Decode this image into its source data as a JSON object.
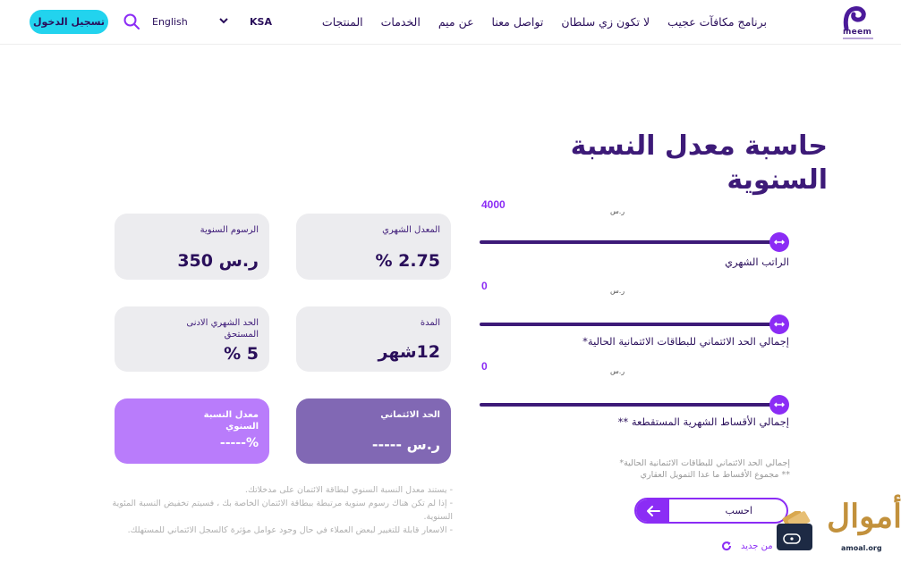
{
  "header": {
    "logo_text": "meem",
    "nav": [
      {
        "label": "المنتجات"
      },
      {
        "label": "الخدمات"
      },
      {
        "label": "عن ميم"
      },
      {
        "label": "تواصل معنا"
      },
      {
        "label": "لا تكون زي سلطان"
      },
      {
        "label": "برنامج مكافآت عجيب"
      }
    ],
    "country": "KSA",
    "language": "English",
    "login_label": "تسجيل الدخول"
  },
  "title": "حاسبة معدل النسبة السنوية",
  "sliders": [
    {
      "value": "4000",
      "currency": "ر.س",
      "label": "الراتب الشهري",
      "fill_fraction": 1.0
    },
    {
      "value": "0",
      "currency": "ر.س",
      "label": "إجمالي الحد الائتماني للبطاقات الائتمانية الحالية*",
      "fill_fraction": 1.0
    },
    {
      "value": "0",
      "currency": "ر.س",
      "label": "إجمالي الأقساط الشهرية المستقطعة **",
      "fill_fraction": 1.0
    }
  ],
  "cards": {
    "monthly_rate": {
      "label": "المعدل الشهري",
      "value": "2.75 %"
    },
    "annual_fees": {
      "label": "الرسوم السنوية",
      "value": "ر.س 350"
    },
    "duration": {
      "label": "المدة",
      "value": "12شهر"
    },
    "min_monthly": {
      "label": "الحد الشهري الادنى المستحق",
      "value": "5 %"
    },
    "credit_limit": {
      "label": "الحد الائتماني",
      "value": "ر.س -----"
    },
    "apr": {
      "label": "معدل النسبة السنوي",
      "value": "%-----"
    }
  },
  "footnotes": [
    "إجمالي الحد الائتماني للبطاقات الائتمانية الحالية*",
    "** مجموع الأقساط ما عدا التمويل العقاري"
  ],
  "disclaimers": [
    "- يستند معدل النسبة السنوي لبطاقة الائتمان على مدخلاتك.",
    "- إذا لم تكن هناك رسوم سنوية مرتبطة ببطاقة الائتمان الخاصة بك ، فسيتم تخفيض النسبة المئوية السنوية.",
    "- الاسعار قابلة للتغيير لبعض العملاء في حال وجود عوامل مؤثرة كالسجل الائتماني للمستهلك."
  ],
  "calculate_label": "احسب",
  "reset_label": "من جديد",
  "watermark": {
    "brand": "أموال",
    "site": "amoal.org"
  },
  "colors": {
    "primary": "#3d1a78",
    "accent": "#8b2cf5",
    "login": "#22d3ee",
    "card_dark": "#8168b4",
    "card_light": "#b97cfb"
  }
}
